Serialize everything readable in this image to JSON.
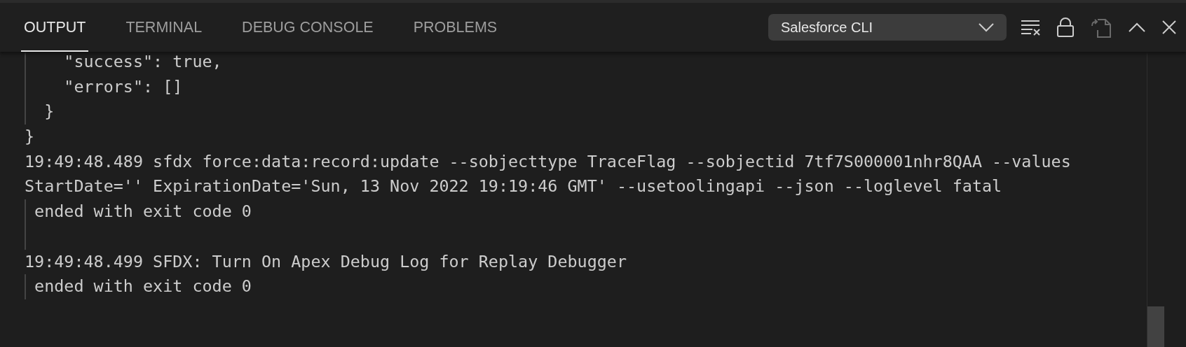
{
  "tabs": [
    {
      "label": "OUTPUT",
      "selected": true
    },
    {
      "label": "TERMINAL",
      "selected": false
    },
    {
      "label": "DEBUG CONSOLE",
      "selected": false
    },
    {
      "label": "PROBLEMS",
      "selected": false
    }
  ],
  "channel_select": {
    "value": "Salesforce CLI"
  },
  "toolbar": [
    {
      "kind": "clear",
      "disabled": false
    },
    {
      "kind": "lock",
      "disabled": false
    },
    {
      "kind": "copy",
      "disabled": true
    },
    {
      "kind": "maximize",
      "disabled": false
    },
    {
      "kind": "close",
      "disabled": false
    }
  ],
  "output_lines": [
    {
      "text": "    \"success\": true,",
      "guide": true
    },
    {
      "text": "    \"errors\": []",
      "guide": true
    },
    {
      "text": "  }",
      "guide": true
    },
    {
      "text": "}",
      "guide": false
    },
    {
      "text": "19:49:48.489 sfdx force:data:record:update --sobjecttype TraceFlag --sobjectid 7tf7S000001nhr8QAA --values",
      "guide": false
    },
    {
      "text": "StartDate='' ExpirationDate='Sun, 13 Nov 2022 19:19:46 GMT' --usetoolingapi --json --loglevel fatal",
      "guide": false
    },
    {
      "text": " ended with exit code 0",
      "guide": true
    },
    {
      "guide": true
    },
    {
      "text": "19:49:48.499 SFDX: Turn On Apex Debug Log for Replay Debugger",
      "guide": false
    },
    {
      "text": " ended with exit code 0",
      "guide": true
    }
  ]
}
